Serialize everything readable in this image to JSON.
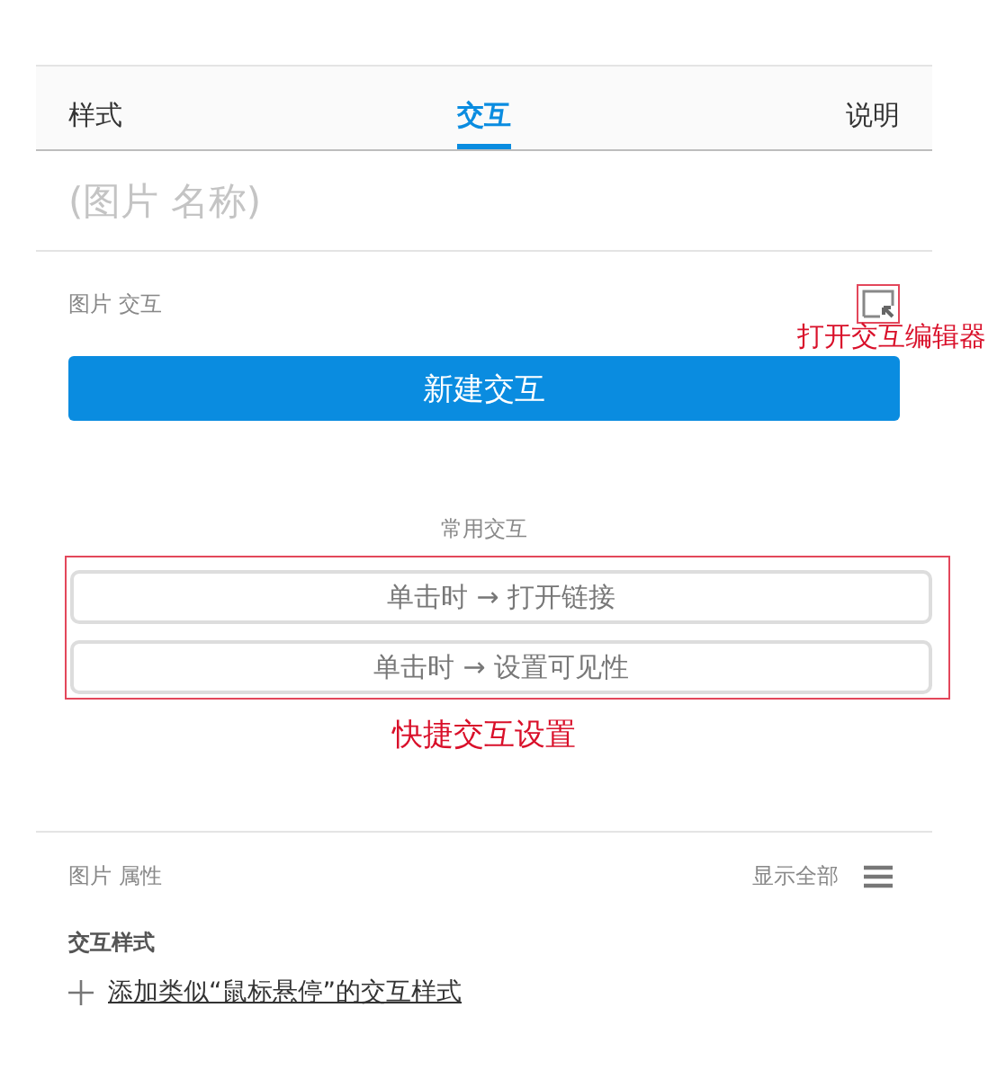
{
  "tabs": [
    {
      "label": "样式",
      "selected": false
    },
    {
      "label": "交互",
      "selected": true
    },
    {
      "label": "说明",
      "selected": false
    }
  ],
  "name_field": {
    "placeholder": "(图片 名称)"
  },
  "interaction_section": {
    "title": "图片 交互",
    "editor_annotation": "打开交互编辑器",
    "new_button": "新建交互"
  },
  "common": {
    "title": "常用交互",
    "items": [
      "单击时 → 打开链接",
      "单击时 → 设置可见性"
    ],
    "annotation": "快捷交互设置"
  },
  "properties": {
    "title": "图片 属性",
    "show_all": "显示全部",
    "style_heading": "交互样式",
    "add_link": "添加类似“鼠标悬停”的交互样式"
  }
}
